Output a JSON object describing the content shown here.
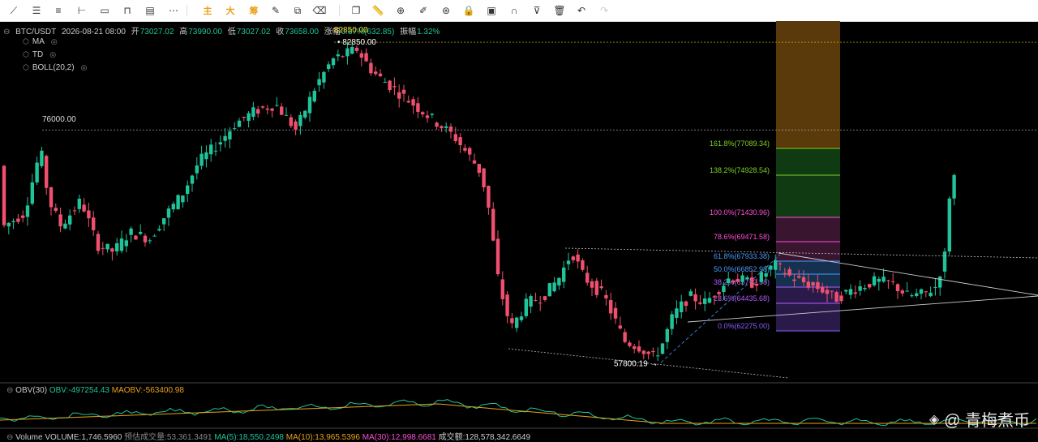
{
  "toolbar": {
    "tools": [
      {
        "name": "line-tool-icon",
        "glyph": "⟋"
      },
      {
        "name": "horizontal-lines-icon",
        "glyph": "☰"
      },
      {
        "name": "parallel-channel-icon",
        "glyph": "≡"
      },
      {
        "name": "horizontal-ray-icon",
        "glyph": "⊢"
      },
      {
        "name": "rectangle-icon",
        "glyph": "▭"
      },
      {
        "name": "price-range-icon",
        "glyph": "⊓"
      },
      {
        "name": "fib-retracement-icon",
        "glyph": "▤"
      },
      {
        "name": "dots-pattern-icon",
        "glyph": "⋯"
      },
      {
        "name": "cn-tool-main",
        "glyph": "主",
        "cn": true
      },
      {
        "name": "cn-tool-big",
        "glyph": "大",
        "cn": true
      },
      {
        "name": "cn-tool-chips",
        "glyph": "筹",
        "cn": true
      },
      {
        "name": "brush-icon",
        "glyph": "✎"
      },
      {
        "name": "transform-icon",
        "glyph": "⧉"
      },
      {
        "name": "eraser-icon",
        "glyph": "⌫"
      },
      {
        "name": "copy-icon",
        "glyph": "❐"
      },
      {
        "name": "ruler-icon",
        "glyph": "📏"
      },
      {
        "name": "zoom-icon",
        "glyph": "⊕"
      },
      {
        "name": "magic-icon",
        "glyph": "✐"
      },
      {
        "name": "visibility-icon",
        "glyph": "⊛"
      },
      {
        "name": "lock-icon",
        "glyph": "🔒"
      },
      {
        "name": "settings-icon",
        "glyph": "▣"
      },
      {
        "name": "magnet-icon",
        "glyph": "∩"
      },
      {
        "name": "filter-icon",
        "glyph": "⊽"
      },
      {
        "name": "delete-icon",
        "glyph": "🗑"
      },
      {
        "name": "undo-icon",
        "glyph": "↶"
      },
      {
        "name": "redo-icon",
        "glyph": "↷",
        "dim": true
      }
    ]
  },
  "header": {
    "symbol": "BTC/USDT",
    "datetime": "2026-08-21 08:00",
    "open_label": "开",
    "open": "73027.02",
    "high_label": "高",
    "high": "73990.00",
    "low_label": "低",
    "low": "73027.02",
    "close_label": "收",
    "close": "73658.00",
    "change_label": "涨幅",
    "change": "0.87%(632.85)",
    "amp_label": "振幅",
    "amp": "1.32%"
  },
  "indicators": [
    "MA",
    "TD",
    "BOLL(20,2)"
  ],
  "colors": {
    "up": "#20c49a",
    "down": "#f0506e",
    "bg": "#000000",
    "accent": "#e8a21a"
  },
  "chart_data": {
    "type": "candlestick",
    "ylim": [
      56500,
      84500
    ],
    "levels": [
      {
        "price": 82850,
        "label": "82850.00",
        "marker": "82850.00"
      },
      {
        "price": 76000,
        "label": "76000.00"
      },
      {
        "price": 57800.19,
        "label": "57800.19"
      }
    ],
    "fib": [
      {
        "label": "161.8%(77089.34)",
        "color": "#7ed321"
      },
      {
        "label": "138.2%(74928.54)",
        "color": "#7ed321"
      },
      {
        "label": "100.0%(71430.96)",
        "color": "#ff4fd8"
      },
      {
        "label": "78.6%(69471.58)",
        "color": "#ff4fd8"
      },
      {
        "label": "61.8%(67933.38)",
        "color": "#4a9cff"
      },
      {
        "label": "50.0%(66852.98)",
        "color": "#4a9cff"
      },
      {
        "label": "38.2%(65772.58)",
        "color": "#b05cff"
      },
      {
        "label": "23.6%(64435.68)",
        "color": "#b05cff"
      },
      {
        "label": "0.0%(62275.00)",
        "color": "#8a5cff"
      }
    ]
  },
  "obv": {
    "title": "OBV(30)",
    "obv": "OBV:-497254.43",
    "maobv": "MAOBV:-563400.98"
  },
  "volume": {
    "title": "Volume",
    "volume": "VOLUME:1,746.5960",
    "predict": "预估成交量:53,361.3491",
    "ma5": "MA(5):18,550.2498",
    "ma10": "MA(10):13,965.5396",
    "ma30": "MA(30):12,998.6681",
    "turnover": "成交额:128,578,342.6649"
  },
  "watermark": "@ 青梅煮币"
}
